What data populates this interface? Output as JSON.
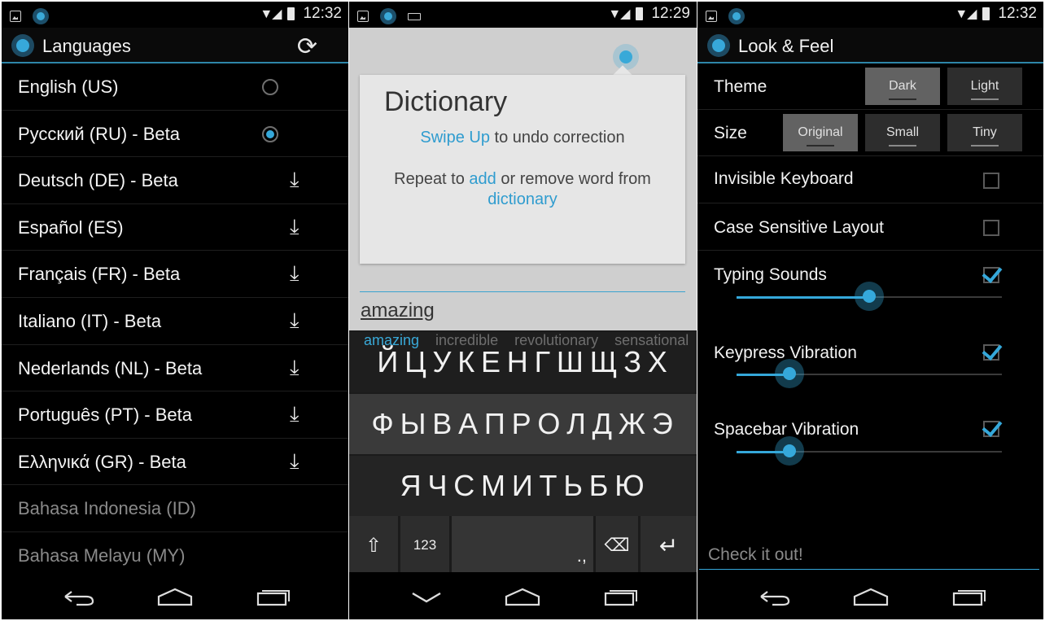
{
  "status_bars": [
    {
      "time": "12:32"
    },
    {
      "time": "12:29"
    },
    {
      "time": "12:32"
    }
  ],
  "languages": {
    "title": "Languages",
    "items": [
      {
        "label": "English (US)",
        "control": "radio",
        "selected": false
      },
      {
        "label": "Русский (RU) - Beta",
        "control": "radio",
        "selected": true
      },
      {
        "label": "Deutsch (DE) - Beta",
        "control": "download"
      },
      {
        "label": "Español (ES)",
        "control": "download"
      },
      {
        "label": "Français (FR) - Beta",
        "control": "download"
      },
      {
        "label": "Italiano (IT) - Beta",
        "control": "download"
      },
      {
        "label": "Nederlands (NL) - Beta",
        "control": "download"
      },
      {
        "label": "Português (PT) - Beta",
        "control": "download"
      },
      {
        "label": "Ελληνικά (GR) - Beta",
        "control": "download"
      },
      {
        "label": "Bahasa Indonesia (ID)",
        "control": "none",
        "dimmed": true
      },
      {
        "label": "Bahasa Melayu (MY)",
        "control": "none",
        "dimmed": true
      }
    ]
  },
  "dictionary": {
    "title": "Dictionary",
    "swipe_up": "Swipe Up",
    "line1_rest": " to undo correction",
    "line2_a": "Repeat to ",
    "line2_add": "add",
    "line2_b": " or remove word from ",
    "line2_dict": "dictionary",
    "typed_word": "amazing"
  },
  "keyboard": {
    "suggestions": [
      "amazing",
      "incredible",
      "revolutionary",
      "sensational"
    ],
    "row1": [
      "Й",
      "Ц",
      "У",
      "К",
      "Е",
      "Н",
      "Г",
      "Ш",
      "Щ",
      "З",
      "Х"
    ],
    "row2": [
      "Ф",
      "Ы",
      "В",
      "А",
      "П",
      "Р",
      "О",
      "Л",
      "Д",
      "Ж",
      "Э"
    ],
    "row3": [
      "Я",
      "Ч",
      "С",
      "М",
      "И",
      "Т",
      "Ь",
      "Б",
      "Ю"
    ],
    "shift_key": "⇧",
    "numbers_key": "123",
    "space_punct": ".,",
    "backspace_key": "⌫",
    "enter_key": "↵"
  },
  "look_feel": {
    "title": "Look & Feel",
    "theme_label": "Theme",
    "theme_options": [
      {
        "label": "Dark",
        "selected": true
      },
      {
        "label": "Light",
        "selected": false
      }
    ],
    "size_label": "Size",
    "size_options": [
      {
        "label": "Original",
        "selected": true
      },
      {
        "label": "Small",
        "selected": false
      },
      {
        "label": "Tiny",
        "selected": false
      }
    ],
    "invisible_keyboard": {
      "label": "Invisible Keyboard",
      "checked": false
    },
    "case_sensitive": {
      "label": "Case Sensitive Layout",
      "checked": false
    },
    "typing_sounds": {
      "label": "Typing Sounds",
      "checked": true,
      "level": 0.5
    },
    "keypress_vibration": {
      "label": "Keypress Vibration",
      "checked": true,
      "level": 0.2
    },
    "spacebar_vibration": {
      "label": "Spacebar Vibration",
      "checked": true,
      "level": 0.2
    },
    "check_placeholder": "Check it out!"
  }
}
